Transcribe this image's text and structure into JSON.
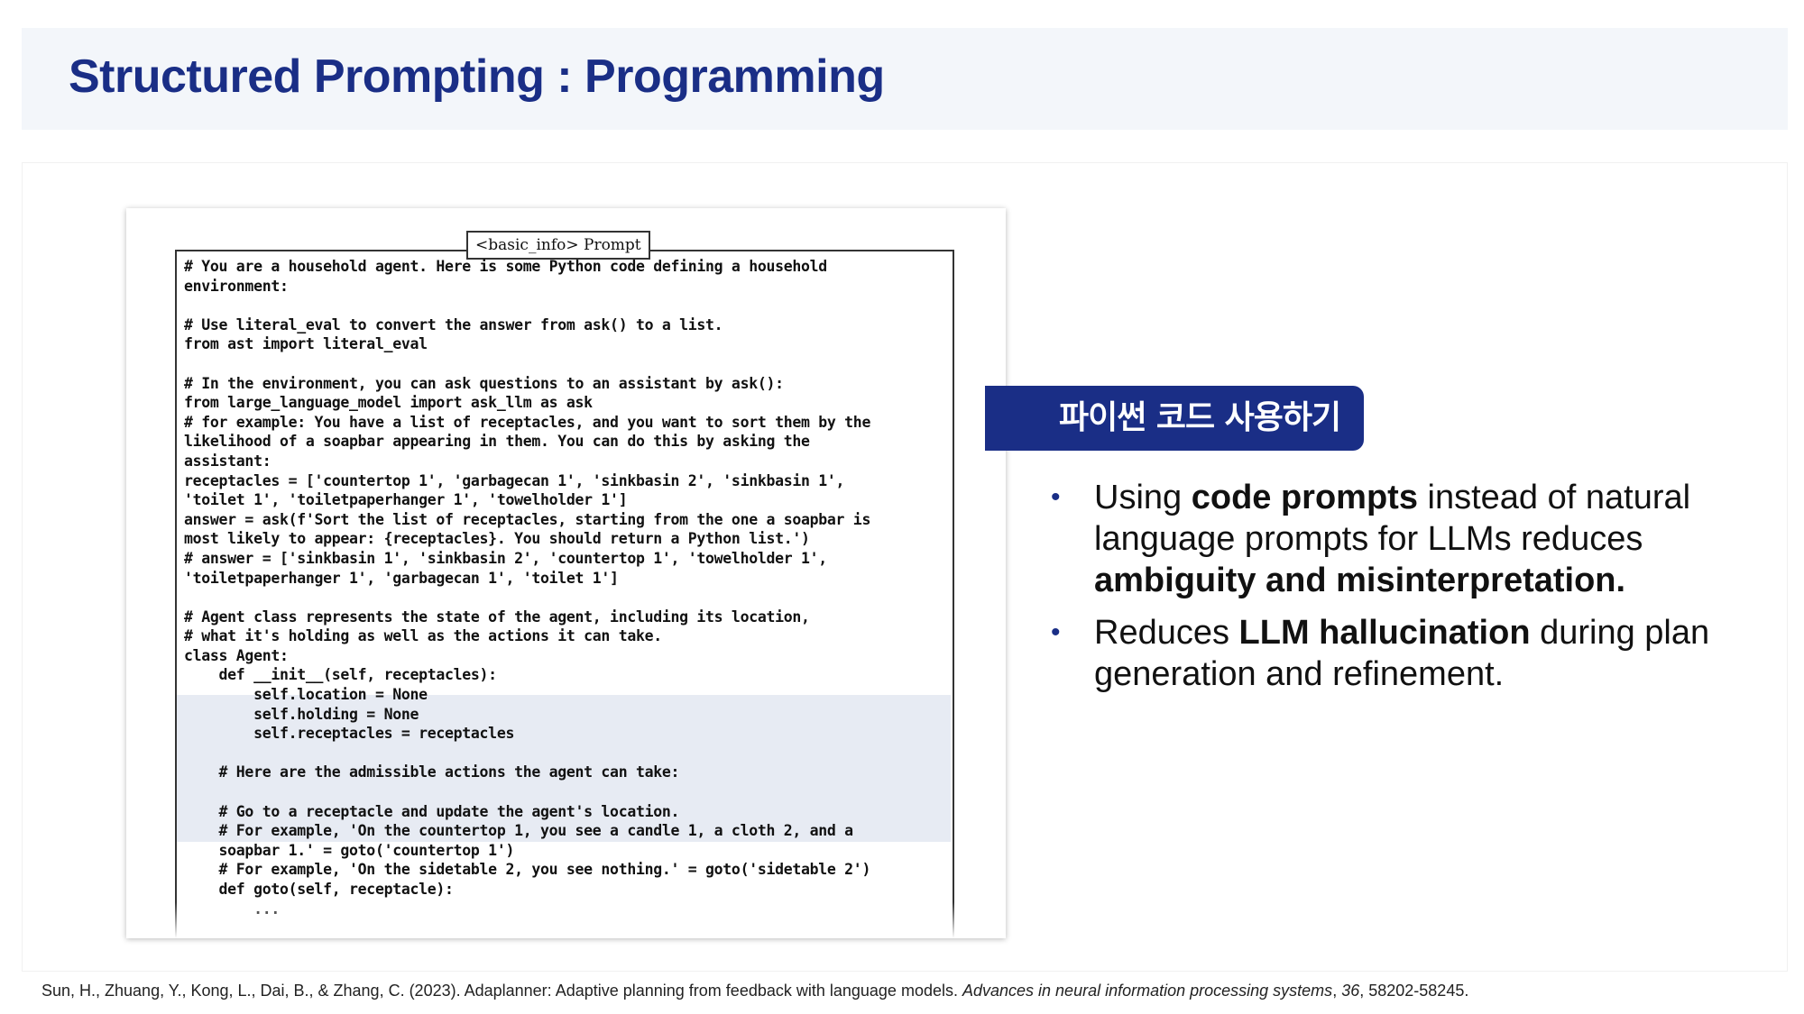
{
  "slide": {
    "title": "Structured Prompting : Programming"
  },
  "figure": {
    "prompt_tag": "<basic_info> Prompt",
    "code": "# You are a household agent. Here is some Python code defining a household\nenvironment:\n\n# Use literal_eval to convert the answer from ask() to a list.\nfrom ast import literal_eval\n\n# In the environment, you can ask questions to an assistant by ask():\nfrom large_language_model import ask_llm as ask\n# for example: You have a list of receptacles, and you want to sort them by the\nlikelihood of a soapbar appearing in them. You can do this by asking the\nassistant:\nreceptacles = ['countertop 1', 'garbagecan 1', 'sinkbasin 2', 'sinkbasin 1',\n'toilet 1', 'toiletpaperhanger 1', 'towelholder 1']\nanswer = ask(f'Sort the list of receptacles, starting from the one a soapbar is\nmost likely to appear: {receptacles}. You should return a Python list.')\n# answer = ['sinkbasin 1', 'sinkbasin 2', 'countertop 1', 'towelholder 1',\n'toiletpaperhanger 1', 'garbagecan 1', 'toilet 1']\n\n# Agent class represents the state of the agent, including its location,\n# what it's holding as well as the actions it can take.\nclass Agent:\n    def __init__(self, receptacles):\n        self.location = None\n        self.holding = None\n        self.receptacles = receptacles\n\n    # Here are the admissible actions the agent can take:\n\n    # Go to a receptacle and update the agent's location.\n    # For example, 'On the countertop 1, you see a candle 1, a cloth 2, and a\n    soapbar 1.' = goto('countertop 1')\n    # For example, 'On the sidetable 2, you see nothing.' = goto('sidetable 2')\n    def goto(self, receptacle):\n        ..."
  },
  "section": {
    "label": "파이썬 코드 사용하기"
  },
  "bullets": [
    {
      "pre": "Using ",
      "bold": "code prompts",
      "post": " instead of natural language prompts for LLMs reduces ",
      "bold2": "ambiguity and misinterpretation.",
      "post2": ""
    },
    {
      "pre": "Reduces ",
      "bold": "LLM hallucination",
      "post": " during plan generation and refinement.",
      "bold2": "",
      "post2": ""
    }
  ],
  "citation": {
    "text": "Sun, H., Zhuang, Y., Kong, L., Dai, B., & Zhang, C. (2023). Adaplanner: Adaptive planning from feedback with language models. ",
    "journal": "Advances in neural information processing systems",
    "sep": ", ",
    "volume": "36",
    "pages": ", 58202-58245."
  },
  "colors": {
    "accent": "#1a2e86",
    "header_bg": "#f3f6fa",
    "highlight": "#e7ebf3"
  }
}
